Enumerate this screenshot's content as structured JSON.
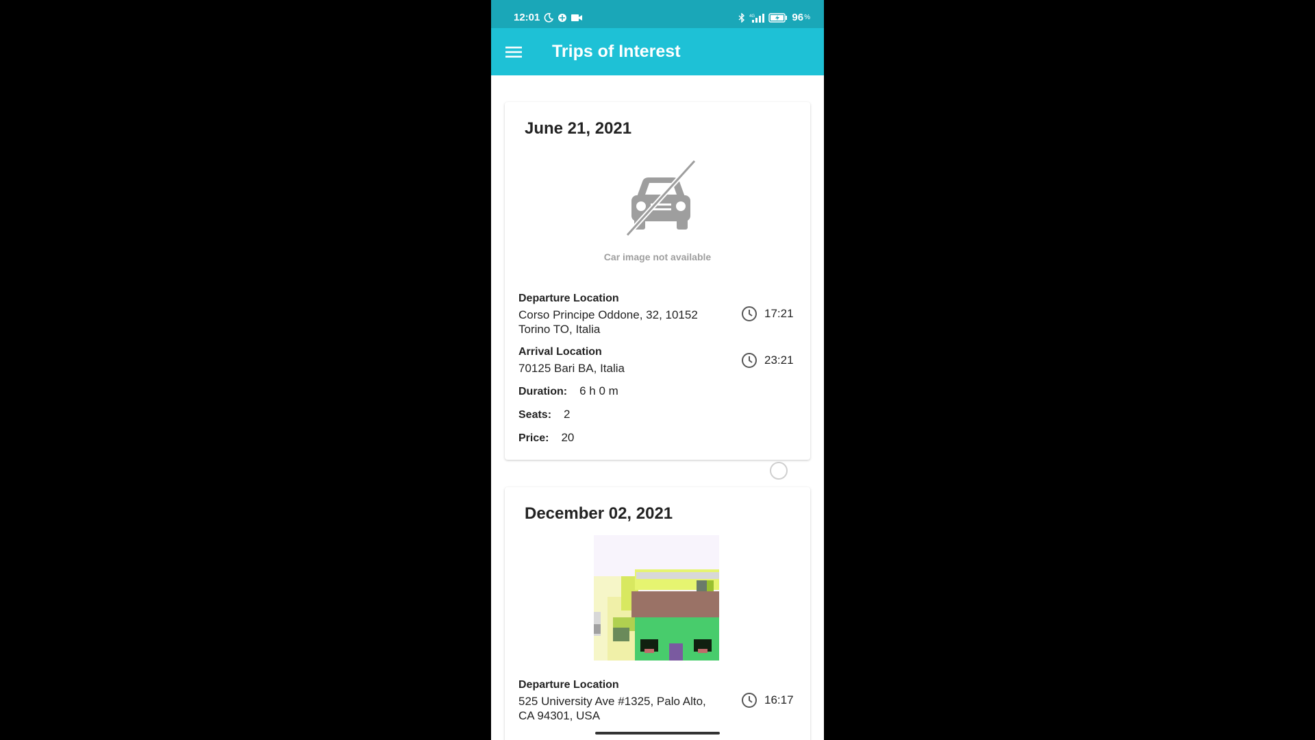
{
  "status_bar": {
    "time": "12:01",
    "battery": "96"
  },
  "app_bar": {
    "title": "Trips of Interest",
    "menu_icon": "hamburger-menu-icon"
  },
  "colors": {
    "status_bar": "#1aa7b8",
    "app_bar": "#1ec1d6",
    "background": "#ffffff"
  },
  "trips": [
    {
      "date": "June 21, 2021",
      "image_caption": "Car image not available",
      "departure_label": "Departure Location",
      "departure_address": "Corso Principe Oddone, 32, 10152 Torino TO, Italia",
      "departure_time": "17:21",
      "arrival_label": "Arrival Location",
      "arrival_address": "70125 Bari BA, Italia",
      "arrival_time": "23:21",
      "duration_label": "Duration:",
      "duration": "6 h 0 m",
      "seats_label": "Seats:",
      "seats": "2",
      "price_label": "Price:",
      "price": "20"
    },
    {
      "date": "December 02, 2021",
      "departure_label": "Departure Location",
      "departure_address": "525 University Ave #1325, Palo Alto, CA 94301, USA",
      "departure_time": "16:17"
    }
  ]
}
